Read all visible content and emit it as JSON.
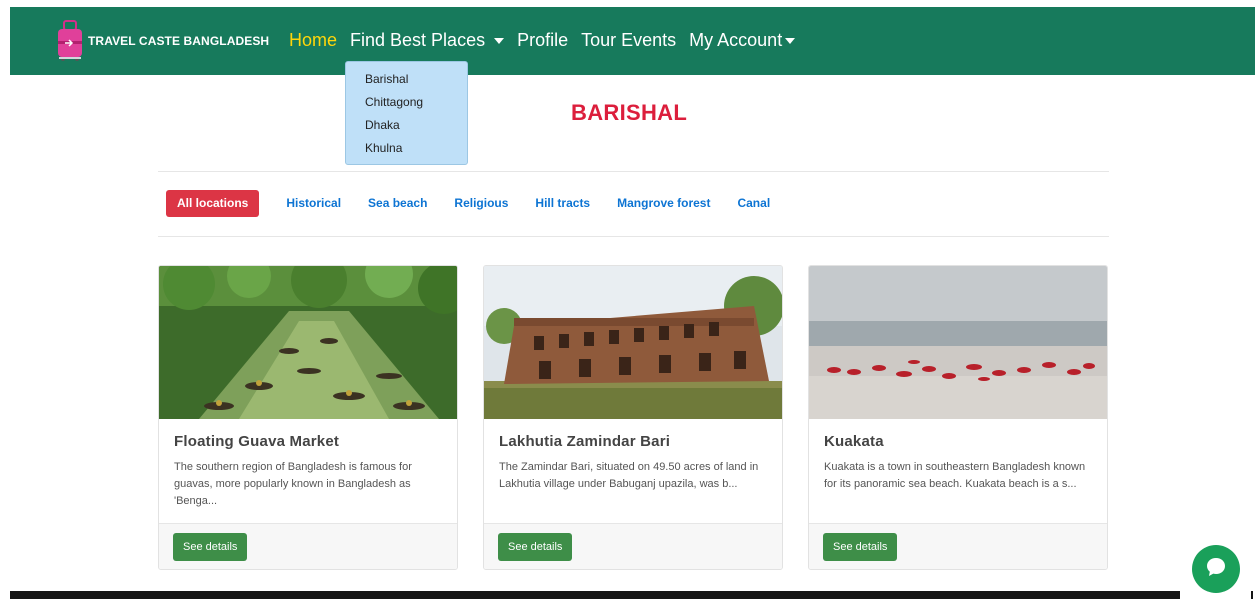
{
  "brand": {
    "name": "TRAVEL CASTE BANGLADESH",
    "logo_icon": "suitcase-icon"
  },
  "nav": {
    "home": "Home",
    "find_places": "Find Best Places",
    "profile": "Profile",
    "tour_events": "Tour Events",
    "my_account": "My Account"
  },
  "dropdown": {
    "items": [
      "Barishal",
      "Chittagong",
      "Dhaka",
      "Khulna"
    ]
  },
  "page": {
    "title": "BARISHAL"
  },
  "filters": [
    "All locations",
    "Historical",
    "Sea beach",
    "Religious",
    "Hill tracts",
    "Mangrove forest",
    "Canal"
  ],
  "cards": [
    {
      "title": "Floating Guava Market",
      "text": "The southern region of Bangladesh is famous for guavas, more popularly known in Bangladesh as 'Benga...",
      "button": "See details"
    },
    {
      "title": "Lakhutia Zamindar Bari",
      "text": "The Zamindar Bari, situated on 49.50 acres of land in Lakhutia village under Babuganj upazila, was b...",
      "button": "See details"
    },
    {
      "title": "Kuakata",
      "text": "Kuakata is a town in southeastern Bangladesh known for its panoramic sea beach. Kuakata beach is a s...",
      "button": "See details"
    }
  ],
  "colors": {
    "navbar": "#177a5c",
    "active_nav": "#ffd60a",
    "title_red": "#dc1e3c",
    "filter_active": "#dc3545",
    "filter_link": "#0d74d3",
    "details_button": "#3e8e48",
    "chat_button": "#1aa05a"
  },
  "icons": {
    "chat": "chat-bubble-icon",
    "caret": "caret-down-icon"
  }
}
